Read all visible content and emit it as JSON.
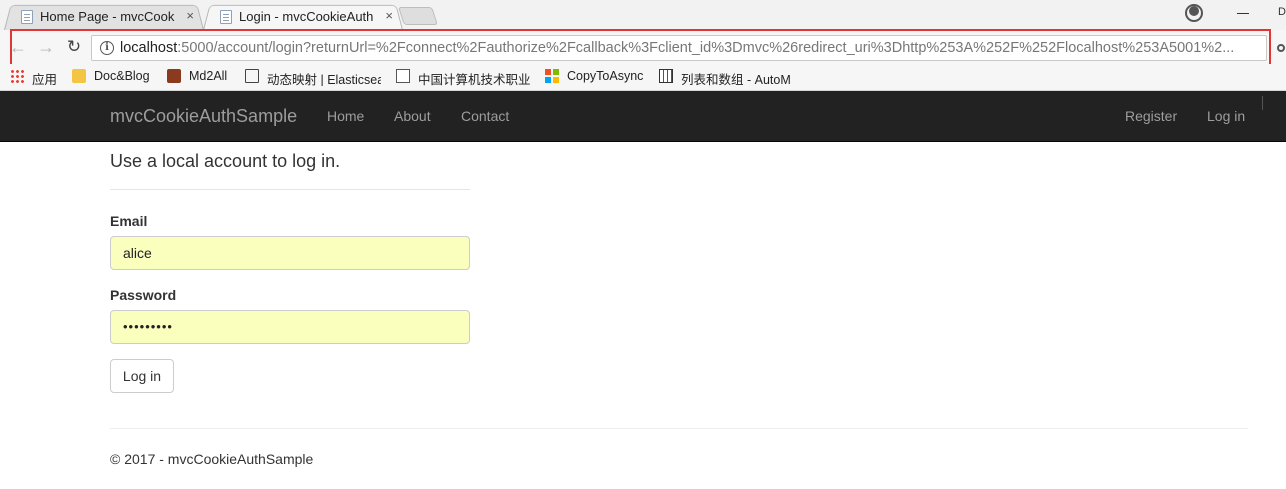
{
  "browser": {
    "tabs": [
      {
        "title": "Home Page - mvcCook",
        "close": "×",
        "active": false
      },
      {
        "title": "Login - mvcCookieAuth",
        "close": "×",
        "active": true
      }
    ],
    "address_bar": {
      "host": "localhost",
      "path": ":5000/account/login?returnUrl=%2Fconnect%2Fauthorize%2Fcallback%3Fclient_id%3Dmvc%26redirect_uri%3Dhttp%253A%252F%252Flocalhost%253A5001%2..."
    },
    "nav_glyphs": {
      "back": "←",
      "forward": "→",
      "reload": "↻"
    },
    "window_extra": "D",
    "bookmarks": [
      {
        "label": "应用",
        "icon": "apps-grid-icon"
      },
      {
        "label": "Doc&Blog",
        "icon": "folder-icon"
      },
      {
        "label": "Md2All",
        "icon": "image-icon"
      },
      {
        "label": "动态映射 | Elasticsea",
        "icon": "book-icon"
      },
      {
        "label": "中国计算机技术职业",
        "icon": "page-icon"
      },
      {
        "label": "CopyToAsync",
        "icon": "windows-logo-icon"
      },
      {
        "label": "列表和数组 - AutoM",
        "icon": "table-icon"
      }
    ]
  },
  "navbar": {
    "brand": "mvcCookieAuthSample",
    "links": [
      "Home",
      "About",
      "Contact"
    ],
    "right_links": [
      "Register",
      "Log in"
    ]
  },
  "login": {
    "heading": "Use a local account to log in.",
    "email_label": "Email",
    "email_value": "alice",
    "password_label": "Password",
    "password_value": "•••••••••",
    "submit_label": "Log in"
  },
  "footer": {
    "text": "© 2017 - mvcCookieAuthSample"
  },
  "colors": {
    "navbar_bg": "#222222",
    "autofill_bg": "#faffbd",
    "highlight_border": "#e03636"
  }
}
